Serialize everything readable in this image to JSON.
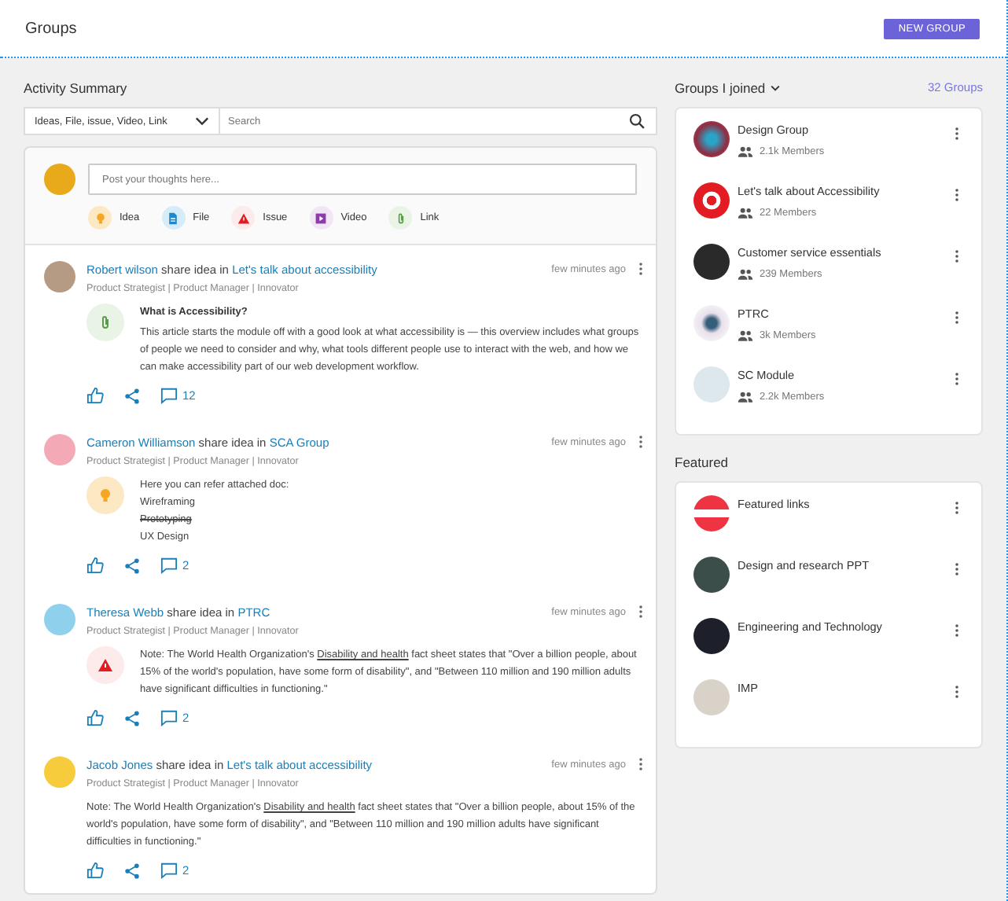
{
  "header": {
    "title": "Groups",
    "button": "NEW GROUP"
  },
  "activity": {
    "title": "Activity Summary",
    "filter": {
      "value": "Ideas, File, issue, Video, Link"
    },
    "search": {
      "placeholder": "Search"
    },
    "composer": {
      "placeholder": "Post your thoughts here...",
      "types": [
        {
          "kind": "idea",
          "label": "Idea"
        },
        {
          "kind": "file",
          "label": "File"
        },
        {
          "kind": "issue",
          "label": "Issue"
        },
        {
          "kind": "video",
          "label": "Video"
        },
        {
          "kind": "link",
          "label": "Link"
        }
      ]
    },
    "posts": [
      {
        "author": "Robert wilson",
        "verb": "share idea in",
        "group": "Let's talk about accessibility",
        "subtitle": "Product Strategist | Product Manager | Innovator",
        "time": "few minutes ago",
        "kind": "link",
        "comments": "12",
        "content": [
          {
            "kind": "heading",
            "text": "What is Accessibility?"
          },
          {
            "kind": "paragraph",
            "text": "This article starts the module off with a good look at what accessibility is — this overview includes what groups of people we need to consider and why, what tools different people use to interact with the web, and how we can make accessibility part of our web development workflow."
          }
        ]
      },
      {
        "author": "Cameron Williamson",
        "verb": "share idea in",
        "group": "SCA Group",
        "subtitle": "Product Strategist | Product Manager | Innovator",
        "time": "few minutes ago",
        "kind": "idea",
        "comments": "2",
        "content": [
          {
            "kind": "line",
            "text": "Here you can refer attached doc:",
            "struck": false
          },
          {
            "kind": "line",
            "text": "Wireframing",
            "struck": false
          },
          {
            "kind": "line",
            "text": "Prototyping",
            "struck": true
          },
          {
            "kind": "line",
            "text": "UX Design",
            "struck": false
          }
        ]
      },
      {
        "author": "Theresa Webb",
        "verb": "share idea in",
        "group": "PTRC",
        "subtitle": "Product Strategist | Product Manager | Innovator",
        "time": "few minutes ago",
        "kind": "issue",
        "comments": "2",
        "content": [
          {
            "kind": "note",
            "before": "Note: The World Health Organization's ",
            "link": "Disability and health",
            "after": " fact sheet states that \"Over a billion people, about 15% of the world's population, have some form of disability\", and \"Between 110 million and 190 million adults have significant difficulties in functioning.\""
          }
        ]
      },
      {
        "author": "Jacob Jones",
        "verb": "share idea in",
        "group": "Let's talk about accessibility",
        "subtitle": "Product Strategist | Product Manager | Innovator",
        "time": "few minutes ago",
        "kind": "plain",
        "comments": "2",
        "content": [
          {
            "kind": "note",
            "before": "Note: The World Health Organization's ",
            "link": "Disability and health",
            "after": " fact sheet states that \"Over a billion people, about 15% of the world's population, have some form of disability\", and \"Between 110 million and 190 million adults have significant difficulties in functioning.\""
          }
        ]
      }
    ]
  },
  "joined": {
    "title": "Groups I joined",
    "count": "32 Groups",
    "groups": [
      {
        "name": "Design Group",
        "members": "2.1k Members"
      },
      {
        "name": "Let's talk about Accessibility",
        "members": "22 Members"
      },
      {
        "name": "Customer service essentials",
        "members": "239 Members"
      },
      {
        "name": "PTRC",
        "members": "3k Members"
      },
      {
        "name": "SC Module",
        "members": "2.2k Members"
      }
    ]
  },
  "featured": {
    "title": "Featured",
    "items": [
      {
        "name": "Featured links"
      },
      {
        "name": "Design and research PPT"
      },
      {
        "name": "Engineering and Technology"
      },
      {
        "name": "IMP"
      }
    ]
  }
}
